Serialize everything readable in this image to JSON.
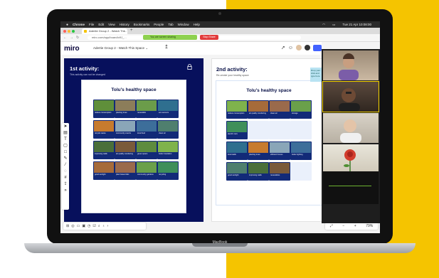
{
  "macbook_label": "MacBook",
  "colors": {
    "miro_navy": "#07105c",
    "tile_blue": "#122a78",
    "accent_yellow": "#f5c400",
    "share_green": "#8ed14f",
    "stop_red": "#e23b3b",
    "miro_blue": "#4262ff"
  },
  "mac_menubar": {
    "apple_icon": "apple-icon",
    "items": [
      "Chrome",
      "File",
      "Edit",
      "View",
      "History",
      "Bookmarks",
      "People",
      "Tab",
      "Window",
      "Help"
    ],
    "clock": "Tue 21 Apr 10:08:00"
  },
  "browser": {
    "tab_title": "Adertie Group 2 - Watch Thi...",
    "tab_close": "×",
    "new_tab": "+",
    "url": "miro.com/app/board/o9J_..."
  },
  "screen_share": {
    "sharing_label": "You are screen sharing",
    "stop_label": "Stop Share"
  },
  "miro": {
    "logo": "miro",
    "board_title": "Adertie Group 2 - Watch This Space",
    "board_title_chevron": "⌄",
    "upload_icon": "↥"
  },
  "activities": [
    {
      "heading": "1st activity:",
      "subheading": "This activity can not be changed",
      "card_title": "Tolu's healthy space",
      "tiles": [
        "reduce consumption",
        "planting trees",
        "renewable",
        "eco sensors",
        "recycle waste",
        "community events",
        "local food",
        "clean air",
        "improving walls",
        "air quality monitoring",
        "green space",
        "better insulation",
        "good sunlight",
        "plant based diet",
        "community gardens",
        "recycling"
      ]
    },
    {
      "heading": "2nd activity:",
      "subheading": "Re-create your healthy space",
      "card_title": "Tolu's healthy space",
      "tiles": [
        "reduce consumption",
        "air quality monitoring",
        "clean air",
        "storage",
        "electric cars",
        "",
        "",
        "",
        "local walls",
        "planting trees",
        "efficient homes",
        "better lighting",
        "good sunlight",
        "improving walls",
        "renewables",
        ""
      ]
    }
  ],
  "sticky_note": "Drop your click and type here",
  "left_toolbar": [
    "cursor-icon",
    "template-icon",
    "text-icon",
    "sticky-note-icon",
    "shape-icon",
    "pen-icon",
    "line-icon",
    "comment-icon",
    "frame-icon",
    "upload-icon",
    "more-icon"
  ],
  "bottom_toolbar": [
    "grid-icon",
    "comment-icon",
    "chat-icon",
    "card-icon",
    "timer-icon",
    "vote-icon",
    "search-icon",
    "mic-icon",
    "more-icon"
  ],
  "zoom_controls": {
    "minus": "−",
    "plus": "+",
    "level": "79%"
  },
  "video_participants": [
    {
      "name": "participant-1"
    },
    {
      "name": "participant-2"
    },
    {
      "name": "participant-3"
    },
    {
      "name": "participant-4"
    }
  ]
}
